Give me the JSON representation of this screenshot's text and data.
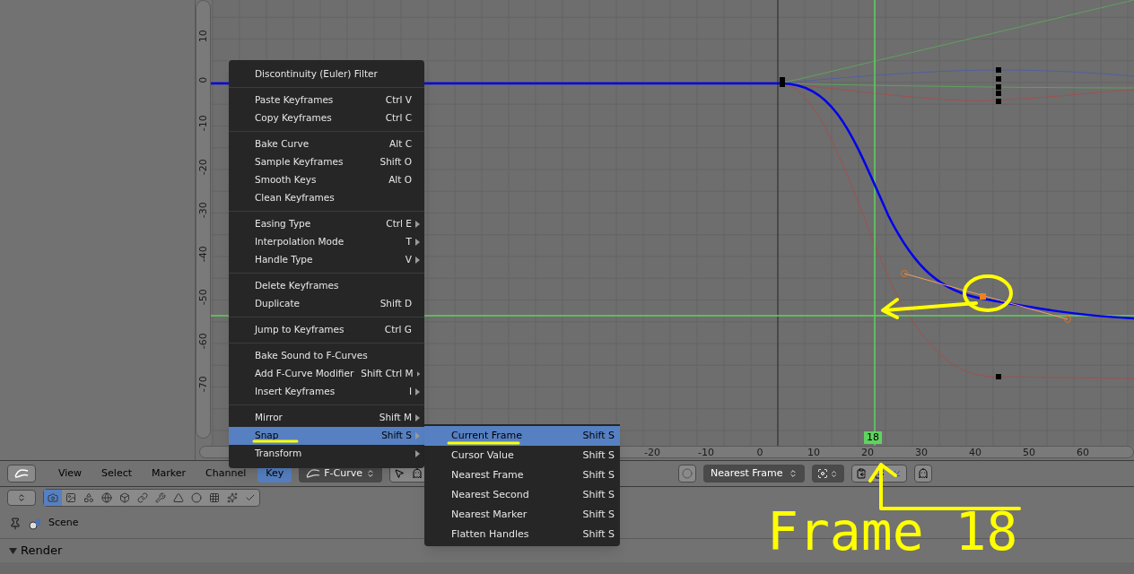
{
  "graph": {
    "y_ruler": [
      "10",
      "0",
      "-10",
      "-20",
      "-30",
      "-40",
      "-50",
      "-60",
      "-70"
    ],
    "x_ruler": [
      "-20",
      "-10",
      "0",
      "10",
      "20",
      "30",
      "40",
      "50",
      "60"
    ],
    "current_frame": "18"
  },
  "key_menu": [
    {
      "kind": "item",
      "label": "Discontinuity (Euler) Filter",
      "submenu": false,
      "selected": false
    },
    {
      "kind": "separator"
    },
    {
      "kind": "item",
      "label": "Paste Keyframes",
      "shortcut": "Ctrl V",
      "submenu": false,
      "selected": false
    },
    {
      "kind": "item",
      "label": "Copy Keyframes",
      "shortcut": "Ctrl C",
      "submenu": false,
      "selected": false
    },
    {
      "kind": "separator"
    },
    {
      "kind": "item",
      "label": "Bake Curve",
      "shortcut": "Alt C",
      "submenu": false,
      "selected": false
    },
    {
      "kind": "item",
      "label": "Sample Keyframes",
      "shortcut": "Shift O",
      "submenu": false,
      "selected": false
    },
    {
      "kind": "item",
      "label": "Smooth Keys",
      "shortcut": "Alt O",
      "submenu": false,
      "selected": false
    },
    {
      "kind": "item",
      "label": "Clean Keyframes",
      "submenu": false,
      "selected": false
    },
    {
      "kind": "separator"
    },
    {
      "kind": "item",
      "label": "Easing Type",
      "shortcut": "Ctrl E",
      "submenu": true,
      "selected": false
    },
    {
      "kind": "item",
      "label": "Interpolation Mode",
      "shortcut": "T",
      "submenu": true,
      "selected": false
    },
    {
      "kind": "item",
      "label": "Handle Type",
      "shortcut": "V",
      "submenu": true,
      "selected": false
    },
    {
      "kind": "separator"
    },
    {
      "kind": "item",
      "label": "Delete Keyframes",
      "submenu": false,
      "selected": false
    },
    {
      "kind": "item",
      "label": "Duplicate",
      "shortcut": "Shift D",
      "submenu": false,
      "selected": false
    },
    {
      "kind": "separator"
    },
    {
      "kind": "item",
      "label": "Jump to Keyframes",
      "shortcut": "Ctrl G",
      "submenu": false,
      "selected": false
    },
    {
      "kind": "separator"
    },
    {
      "kind": "item",
      "label": "Bake Sound to F-Curves",
      "submenu": false,
      "selected": false
    },
    {
      "kind": "item",
      "label": "Add F-Curve Modifier",
      "shortcut": "Shift Ctrl M",
      "submenu": true,
      "selected": false
    },
    {
      "kind": "item",
      "label": "Insert Keyframes",
      "shortcut": "I",
      "submenu": true,
      "selected": false
    },
    {
      "kind": "separator"
    },
    {
      "kind": "item",
      "label": "Mirror",
      "shortcut": "Shift M",
      "submenu": true,
      "selected": false
    },
    {
      "kind": "item",
      "label": "Snap",
      "shortcut": "Shift S",
      "submenu": true,
      "selected": true
    },
    {
      "kind": "item",
      "label": "Transform",
      "submenu": true,
      "selected": false
    }
  ],
  "snap_menu": [
    {
      "label": "Current Frame",
      "shortcut": "Shift S",
      "selected": true
    },
    {
      "label": "Cursor Value",
      "shortcut": "Shift S",
      "selected": false
    },
    {
      "label": "Nearest Frame",
      "shortcut": "Shift S",
      "selected": false
    },
    {
      "label": "Nearest Second",
      "shortcut": "Shift S",
      "selected": false
    },
    {
      "label": "Nearest Marker",
      "shortcut": "Shift S",
      "selected": false
    },
    {
      "label": "Flatten Handles",
      "shortcut": "Shift S",
      "selected": false
    }
  ],
  "header": {
    "menus": [
      {
        "label": "View",
        "selected": false
      },
      {
        "label": "Select",
        "selected": false
      },
      {
        "label": "Marker",
        "selected": false
      },
      {
        "label": "Channel",
        "selected": false
      },
      {
        "label": "Key",
        "selected": true
      }
    ],
    "mode": "F-Curve",
    "snap_mode": "Nearest Frame"
  },
  "properties_tabs": [
    {
      "selected": true
    },
    {
      "selected": false
    },
    {
      "selected": false
    },
    {
      "selected": false
    },
    {
      "selected": false
    },
    {
      "selected": false
    },
    {
      "selected": false
    },
    {
      "selected": false
    },
    {
      "selected": false
    },
    {
      "selected": false
    },
    {
      "selected": false
    },
    {
      "selected": false
    }
  ],
  "scene": "Scene",
  "panel": {
    "title": "Render",
    "expanded": true
  },
  "annotation": "Frame 18"
}
